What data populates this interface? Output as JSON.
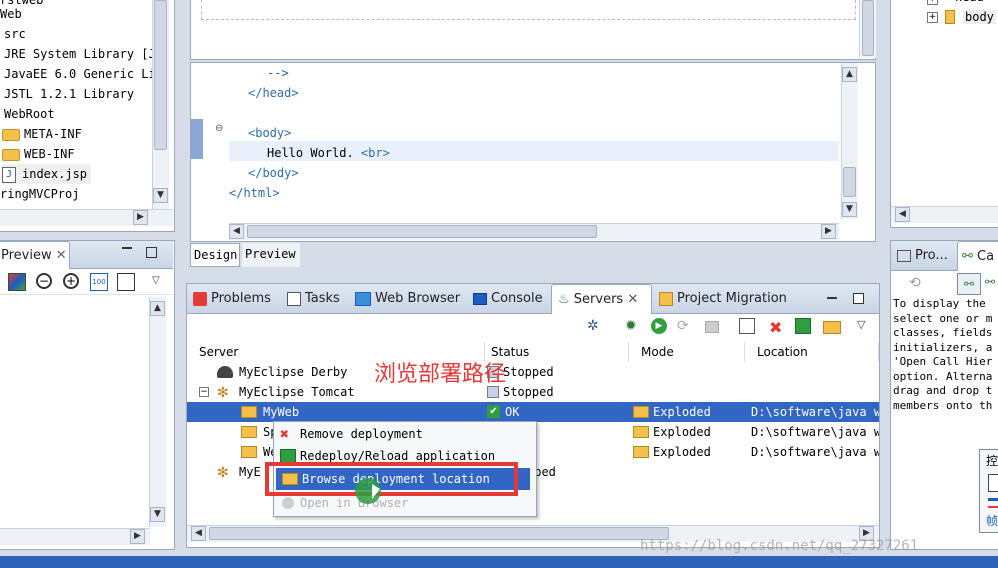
{
  "explorer": {
    "items": [
      "rstweb",
      "Web",
      "src",
      "JRE System Library [J",
      "JavaEE 6.0 Generic Li",
      "JSTL 1.2.1 Library",
      "WebRoot",
      "META-INF",
      "WEB-INF",
      "index.jsp",
      "ringMVCProj"
    ]
  },
  "editor": {
    "lines": [
      "-->",
      "</head>",
      "",
      "<body>",
      "Hello World. <br>",
      "</body>",
      "</html>"
    ],
    "tabs": [
      "Design",
      "Preview"
    ]
  },
  "preview_panel": {
    "title": "Preview"
  },
  "outline": {
    "item1": "head",
    "item2": "body"
  },
  "right_panel": {
    "tabs": [
      "Pro...",
      "Ca"
    ],
    "help_text": [
      "To display the",
      "select one or m",
      "classes, fields",
      "initializers, a",
      "'Open Call Hier",
      "option. Alterna",
      "drag and drop t",
      "members onto th"
    ],
    "chinese_button": "控",
    "chinese_label": "帧"
  },
  "bottom_tabs": {
    "problems": "Problems",
    "tasks": "Tasks",
    "web_browser": "Web Browser",
    "console": "Console",
    "servers": "Servers",
    "project_migration": "Project Migration"
  },
  "servers": {
    "columns": [
      "Server",
      "Status",
      "Mode",
      "Location"
    ],
    "rows": [
      {
        "name": "MyEclipse Derby",
        "status": "Stopped",
        "mode": "",
        "location": ""
      },
      {
        "name": "MyEclipse Tomcat",
        "status": "Stopped",
        "mode": "",
        "location": ""
      },
      {
        "name": "MyWeb",
        "status": "OK",
        "mode": "Exploded",
        "location": "D:\\software\\java w"
      },
      {
        "name": "Sp",
        "status": "",
        "mode": "Exploded",
        "location": "D:\\software\\java w"
      },
      {
        "name": "We",
        "status": "",
        "mode": "Exploded",
        "location": "D:\\software\\java w"
      },
      {
        "name": "MyE",
        "status": "pped",
        "mode": "",
        "location": ""
      }
    ]
  },
  "context_menu": {
    "items": [
      "Remove deployment",
      "Redeploy/Reload application",
      "Browse deployment location",
      "Open in Browser"
    ]
  },
  "annotation": {
    "text": "浏览部署路径",
    "color": "#e53935"
  },
  "watermark": "https://blog.csdn.net/qq_27327261",
  "colors": {
    "selection": "#3166c5",
    "highlight_box": "#e53935",
    "accent": "#1a5dbf"
  }
}
